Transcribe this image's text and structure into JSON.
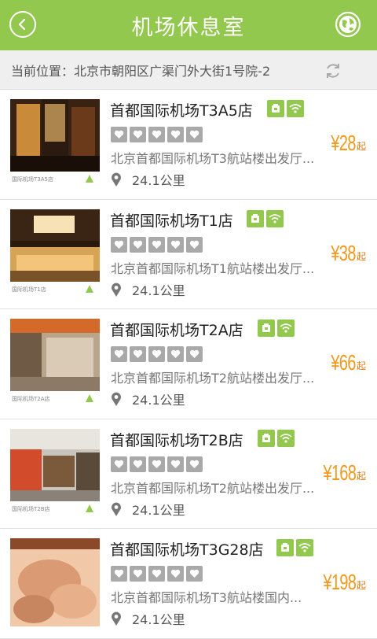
{
  "header": {
    "title": "机场休息室",
    "back_icon": "back-arrow-icon",
    "globe_icon": "globe-icon"
  },
  "location": {
    "text": "当前位置：北京市朝阳区广渠门外大街1号院-2",
    "refresh_icon": "refresh-icon"
  },
  "colors": {
    "brand": "#93c84e",
    "price": "#f09a1e",
    "heart_box": "#a9a9a9"
  },
  "items": [
    {
      "name": "首都国际机场T3A5店",
      "address": "北京首都国际机场T3航站楼出发厅...",
      "distance": "24.1公里",
      "price": "¥28",
      "price_unit": "起",
      "thumb_caption": "国际机场T3A5店",
      "thumb_colors": [
        "#4a2a14",
        "#c98b3a",
        "#2a1a10"
      ]
    },
    {
      "name": "首都国际机场T1店",
      "address": "北京首都国际机场T1航站楼出发厅...",
      "distance": "24.1公里",
      "price": "¥38",
      "price_unit": "起",
      "thumb_caption": "国际机场T1店",
      "thumb_colors": [
        "#2a1a0c",
        "#d7a354",
        "#f6e2b4"
      ]
    },
    {
      "name": "首都国际机场T2A店",
      "address": "北京首都国际机场T2航站楼出发厅...",
      "distance": "24.1公里",
      "price": "¥66",
      "price_unit": "起",
      "thumb_caption": "国际机场T2A店",
      "thumb_colors": [
        "#d46a2a",
        "#b8a58c",
        "#6f5a45"
      ]
    },
    {
      "name": "首都国际机场T2B店",
      "address": "北京首都国际机场T2航站楼出发厅...",
      "distance": "24.1公里",
      "price": "¥168",
      "price_unit": "起",
      "thumb_caption": "国际机场T2B店",
      "thumb_colors": [
        "#c9c4bc",
        "#7a5a3a",
        "#d24b2a"
      ]
    },
    {
      "name": "首都国际机场T3G28店",
      "address": "北京首都国际机场T3航站楼国内...",
      "distance": "24.1公里",
      "price": "¥198",
      "price_unit": "起",
      "thumb_caption": "",
      "thumb_colors": [
        "#f2c9a8",
        "#d99a74",
        "#8a4a2a"
      ]
    }
  ],
  "tags": [
    "phone-icon",
    "wifi-icon"
  ],
  "rating_icon": "heart-icon",
  "distance_icon": "location-pin-icon"
}
